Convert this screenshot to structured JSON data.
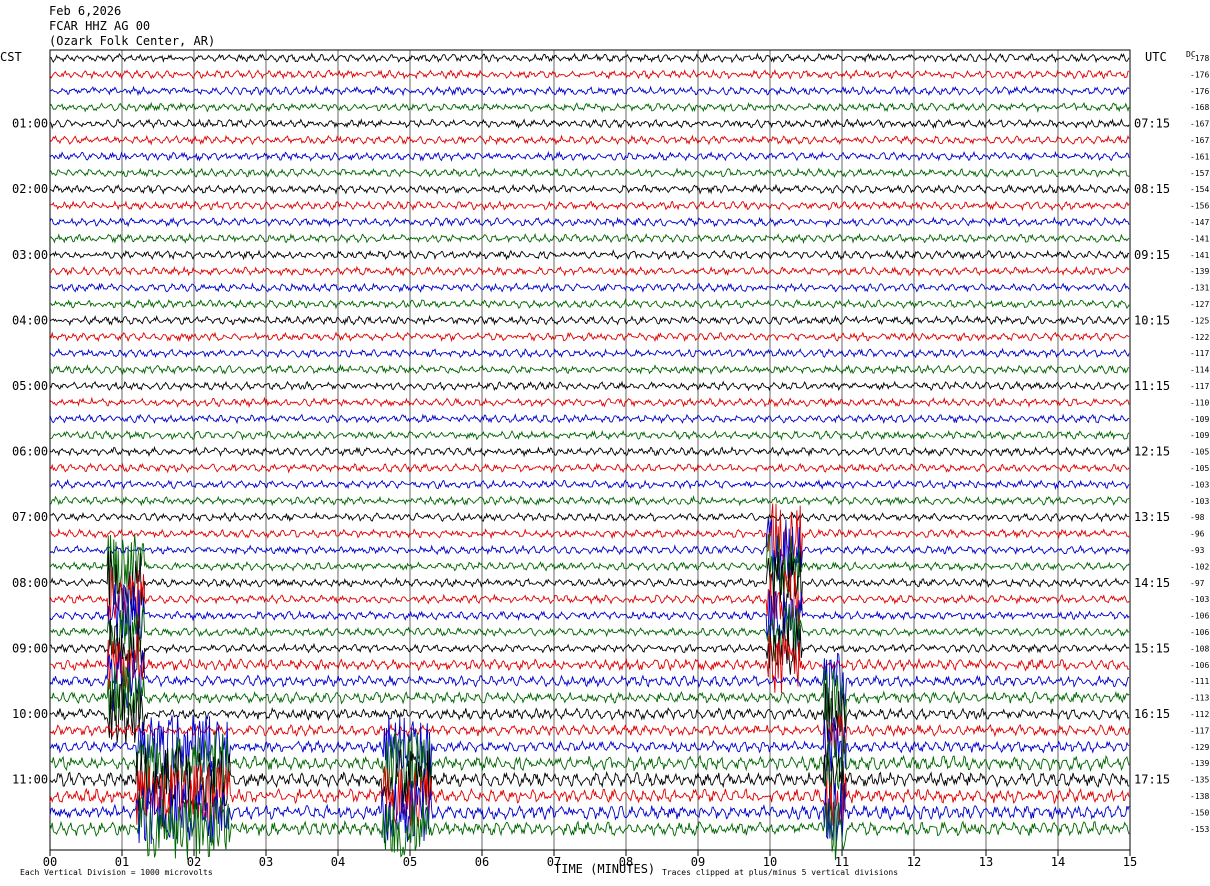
{
  "header": {
    "date": "Feb 6,2026",
    "station": "FCAR HHZ AG 00",
    "location": "(Ozark Folk Center, AR)"
  },
  "left_axis_label": "CST",
  "right_axis_label": "UTC",
  "dc_label": "DC",
  "footer": {
    "xlabel": "TIME (MINUTES)",
    "division_note": "Each Vertical Division = 1000 microvolts",
    "clip_note": "Traces clipped at plus/minus 5 vertical divisions"
  },
  "chart_data": {
    "type": "line",
    "xlim": [
      0,
      15
    ],
    "x_ticks": [
      "00",
      "01",
      "02",
      "03",
      "04",
      "05",
      "06",
      "07",
      "08",
      "09",
      "10",
      "11",
      "12",
      "13",
      "14",
      "15"
    ],
    "trace_colors": [
      "#000000",
      "#e00000",
      "#0000cc",
      "#006600"
    ],
    "trace_count": 48,
    "cst_labels": [
      {
        "row": 4,
        "label": "01:00"
      },
      {
        "row": 8,
        "label": "02:00"
      },
      {
        "row": 12,
        "label": "03:00"
      },
      {
        "row": 16,
        "label": "04:00"
      },
      {
        "row": 20,
        "label": "05:00"
      },
      {
        "row": 24,
        "label": "06:00"
      },
      {
        "row": 28,
        "label": "07:00"
      },
      {
        "row": 32,
        "label": "08:00"
      },
      {
        "row": 36,
        "label": "09:00"
      },
      {
        "row": 40,
        "label": "10:00"
      },
      {
        "row": 44,
        "label": "11:00"
      }
    ],
    "utc_labels": [
      {
        "row": 4,
        "label": "07:15"
      },
      {
        "row": 8,
        "label": "08:15"
      },
      {
        "row": 12,
        "label": "09:15"
      },
      {
        "row": 16,
        "label": "10:15"
      },
      {
        "row": 20,
        "label": "11:15"
      },
      {
        "row": 24,
        "label": "12:15"
      },
      {
        "row": 28,
        "label": "13:15"
      },
      {
        "row": 32,
        "label": "14:15"
      },
      {
        "row": 36,
        "label": "15:15"
      },
      {
        "row": 40,
        "label": "16:15"
      },
      {
        "row": 44,
        "label": "17:15"
      }
    ],
    "dc_offsets": [
      "-178",
      "-176",
      "-176",
      "-168",
      "-167",
      "-167",
      "-161",
      "-157",
      "-154",
      "-156",
      "-147",
      "-141",
      "-141",
      "-139",
      "-131",
      "-127",
      "-125",
      "-122",
      "-117",
      "-114",
      "-117",
      "-110",
      "-109",
      "-109",
      "-105",
      "-105",
      "-103",
      "-103",
      "-98",
      "-96",
      "-93",
      "-102",
      "-97",
      "-103",
      "-106",
      "-106",
      "-108",
      "-106",
      "-111",
      "-113",
      "-112",
      "-117",
      "-129",
      "-139",
      "-135",
      "-138",
      "-150",
      "-153"
    ],
    "events": [
      {
        "start_row": 31,
        "end_row": 40,
        "x_min": 0.8,
        "x_max": 1.3,
        "color_row": 32
      },
      {
        "start_row": 29,
        "end_row": 37,
        "x_min": 9.95,
        "x_max": 10.45,
        "color_row": 33
      },
      {
        "start_row": 38,
        "end_row": 47,
        "x_min": 10.75,
        "x_max": 11.05
      },
      {
        "start_row": 42,
        "end_row": 48,
        "x_min": 1.2,
        "x_max": 2.5
      },
      {
        "start_row": 42,
        "end_row": 48,
        "x_min": 4.6,
        "x_max": 5.3
      }
    ]
  }
}
